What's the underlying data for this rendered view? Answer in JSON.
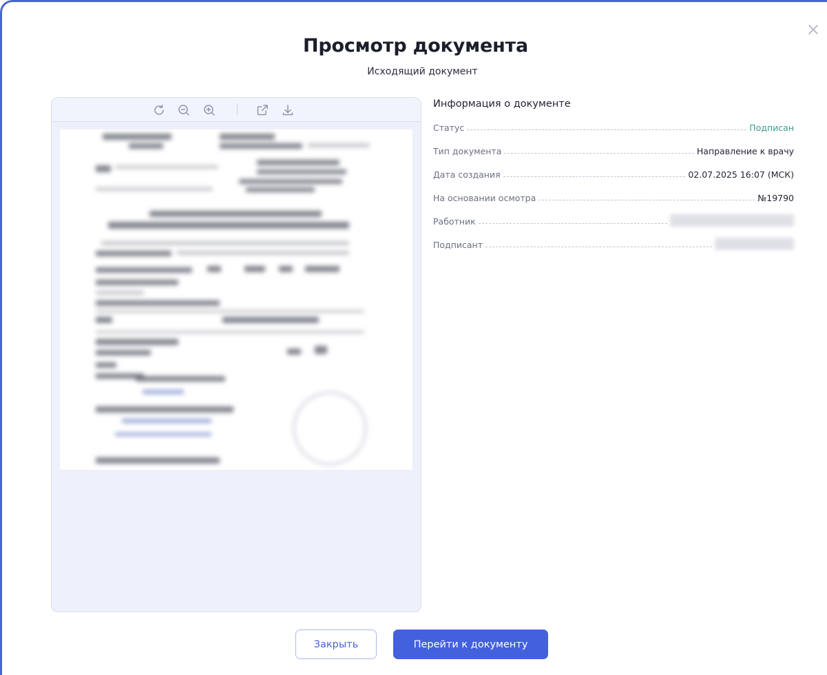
{
  "dialog": {
    "title": "Просмотр документа",
    "subtitle": "Исходящий документ",
    "close_icon": "close-icon"
  },
  "viewer": {
    "toolbar": {
      "rotate_icon": "rotate-icon",
      "zoom_out_icon": "zoom-out-icon",
      "zoom_in_icon": "zoom-in-icon",
      "open_external_icon": "open-external-icon",
      "download_icon": "download-icon"
    }
  },
  "info": {
    "title": "Информация о документе",
    "rows": [
      {
        "label": "Статус",
        "value": "Подписан"
      },
      {
        "label": "Тип документа",
        "value": "Направление к врачу"
      },
      {
        "label": "Дата создания",
        "value": "02.07.2025 16:07 (МСК)"
      },
      {
        "label": "На основании осмотра",
        "value": "№19790"
      },
      {
        "label": "Работник",
        "value": ""
      },
      {
        "label": "Подписант",
        "value": ""
      }
    ]
  },
  "buttons": {
    "close_label": "Закрыть",
    "go_label": "Перейти к документу"
  },
  "colors": {
    "accent": "#4361dd",
    "status_signed": "#3d9a8f",
    "border": "#4a63d9"
  }
}
